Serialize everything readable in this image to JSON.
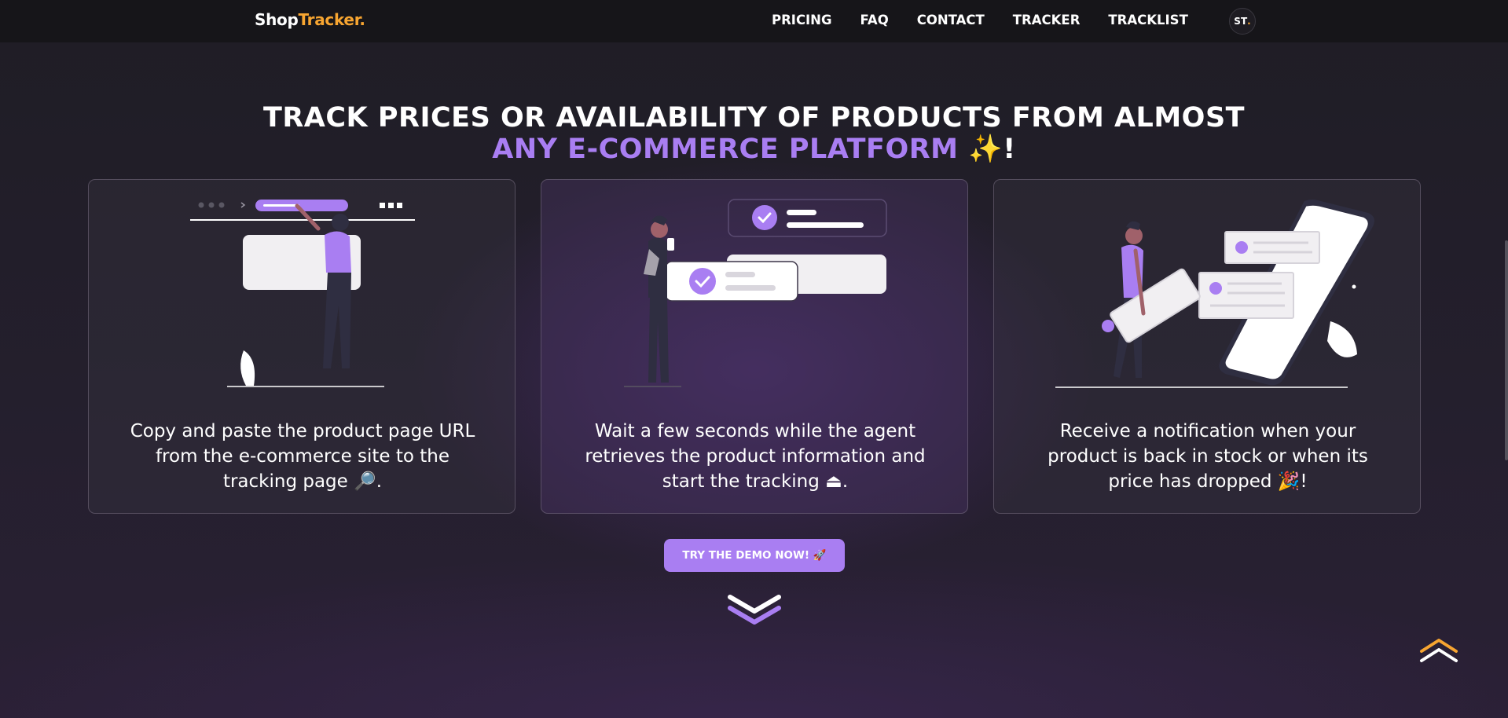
{
  "navbar": {
    "logo_part1": "Shop",
    "logo_part2": "Tracker",
    "logo_part3": ".",
    "links": [
      "PRICING",
      "FAQ",
      "CONTACT",
      "TRACKER",
      "TRACKLIST"
    ],
    "avatar_part1": "ST",
    "avatar_part2": "."
  },
  "hero": {
    "line1": "TRACK PRICES OR AVAILABILITY OF PRODUCTS FROM ALMOST",
    "line2_highlight": "ANY E-COMMERCE PLATFORM",
    "line2_emoji": "✨",
    "line2_end": "!"
  },
  "cards": [
    {
      "text": "Copy and paste the product page URL from the e-commerce site to the tracking page 🔎."
    },
    {
      "text": "Wait a few seconds while the agent retrieves the product information and start the tracking ⏏."
    },
    {
      "text": "Receive a notification when your product is back in stock or when its price has dropped 🎉!"
    }
  ],
  "cta": {
    "label": "TRY THE DEMO NOW! 🚀"
  },
  "icons": {
    "scroll_down": "double-chevron-down-icon",
    "scroll_top": "double-chevron-up-icon"
  },
  "colors": {
    "accent_purple": "#a97ef2",
    "accent_orange": "#f7a531",
    "navbar_bg": "#161519"
  }
}
